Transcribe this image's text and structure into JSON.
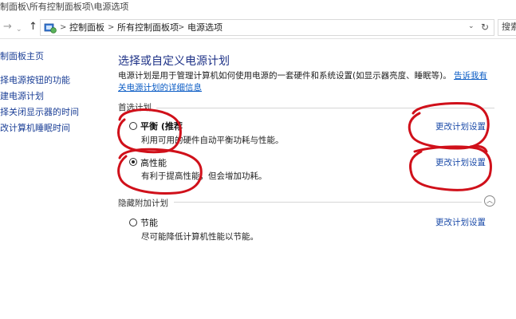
{
  "window": {
    "title_path": "制面板\\所有控制面板项\\电源选项"
  },
  "nav": {
    "back": "→",
    "forward": "→",
    "up": "↑"
  },
  "breadcrumb": {
    "items": [
      "控制面板",
      "所有控制面板项",
      "电源选项"
    ],
    "separator": ">"
  },
  "search": {
    "placeholder": "搜索"
  },
  "sidebar": {
    "items": [
      {
        "label": "制面板主页"
      },
      {
        "label": "择电源按钮的功能"
      },
      {
        "label": "建电源计划"
      },
      {
        "label": "择关闭显示器的时间"
      },
      {
        "label": "改计算机睡眠时间"
      }
    ]
  },
  "main": {
    "title": "选择或自定义电源计划",
    "description": "电源计划是用于管理计算机如何使用电源的一套硬件和系统设置(如显示器亮度、睡眠等)。",
    "description_link": "告诉我有关电源计划的详细信息",
    "preferred_section": "首选计划",
    "hidden_section": "隐藏附加计划",
    "plans": [
      {
        "name": "平衡 (推荐",
        "description": "利用可用的硬件自动平衡功耗与性能。",
        "selected": false,
        "link": "更改计划设置"
      },
      {
        "name": "高性能",
        "description": "有利于提高性能，但会增加功耗。",
        "selected": true,
        "link": "更改计划设置"
      },
      {
        "name": "节能",
        "description": "尽可能降低计算机性能以节能。",
        "selected": false,
        "link": "更改计划设置"
      }
    ]
  },
  "annotation_color": "#d0101a"
}
